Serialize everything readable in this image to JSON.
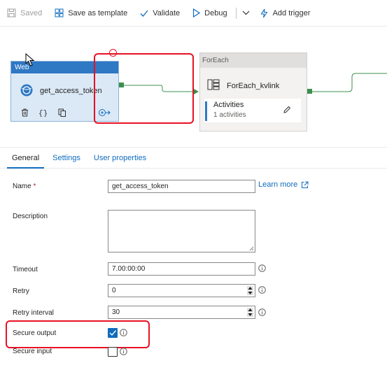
{
  "toolbar": {
    "saved_label": "Saved",
    "save_template_label": "Save as template",
    "validate_label": "Validate",
    "debug_label": "Debug",
    "add_trigger_label": "Add trigger"
  },
  "canvas": {
    "web_activity": {
      "type_label": "Web",
      "name": "get_access_token"
    },
    "foreach_activity": {
      "type_label": "ForEach",
      "name": "ForEach_kvlink",
      "activities_label": "Activities",
      "activities_count": "1 activities"
    }
  },
  "tabs": [
    {
      "label": "General"
    },
    {
      "label": "Settings"
    },
    {
      "label": "User properties"
    }
  ],
  "form": {
    "name_label": "Name",
    "name_required_mark": "*",
    "name_value": "get_access_token",
    "learn_more_label": "Learn more",
    "description_label": "Description",
    "timeout_label": "Timeout",
    "timeout_value": "7.00:00:00",
    "retry_label": "Retry",
    "retry_value": "0",
    "retry_interval_label": "Retry interval",
    "retry_interval_value": "30",
    "secure_output_label": "Secure output",
    "secure_output_checked": true,
    "secure_input_label": "Secure input",
    "secure_input_checked": false
  },
  "colors": {
    "accent": "#0f6cbd",
    "web_header": "#2f78c4",
    "highlight_red": "#e81123",
    "port_green": "#3c8f4e"
  }
}
